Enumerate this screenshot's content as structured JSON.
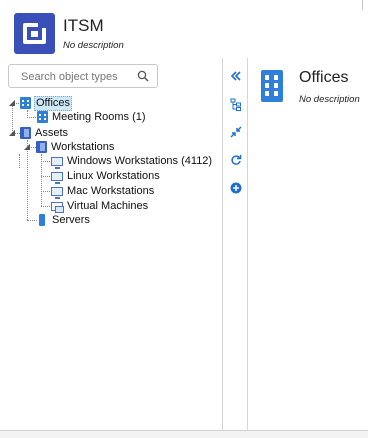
{
  "header": {
    "title": "ITSM",
    "subtitle": "No description",
    "logo_icon": "itsm-logo"
  },
  "search": {
    "placeholder": "Search object types",
    "icon": "search-icon"
  },
  "tree": {
    "offices": "Offices",
    "meeting_rooms": "Meeting Rooms (1)",
    "assets": "Assets",
    "workstations": "Workstations",
    "windows_workstations": "Windows Workstations (4112)",
    "linux_workstations": "Linux Workstations",
    "mac_workstations": "Mac Workstations",
    "virtual_machines": "Virtual Machines",
    "servers": "Servers"
  },
  "toolbar": {
    "items": [
      "collapse-panel-icon",
      "tree-view-icon",
      "collapse-all-icon",
      "refresh-icon",
      "add-icon"
    ]
  },
  "detail": {
    "title": "Offices",
    "subtitle": "No description"
  },
  "colors": {
    "brand": "#3b4fb8",
    "accent": "#1f6fd1",
    "selection": "#cde8f7"
  }
}
